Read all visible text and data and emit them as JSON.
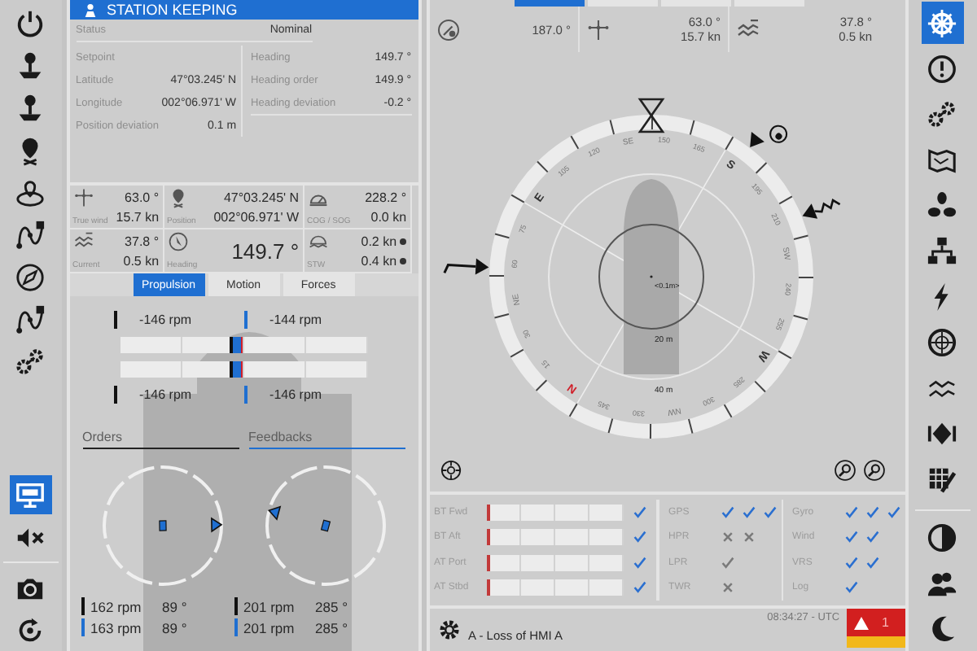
{
  "left_toolbar": [
    {
      "selected": false
    },
    {
      "selected": false
    },
    {
      "selected": false
    },
    {
      "selected": false
    },
    {
      "selected": false
    },
    {
      "selected": false
    },
    {
      "selected": false
    },
    {
      "selected": false
    },
    {
      "selected": false
    },
    {
      "selected": true
    },
    {
      "selected": false
    },
    {
      "selected": false
    },
    {
      "selected": false
    }
  ],
  "station_keeping": {
    "title": "STATION KEEPING",
    "status_label": "Status",
    "status": "Nominal",
    "setpoint": {
      "title": "Setpoint",
      "rows": [
        {
          "label": "Latitude",
          "value": "47°03.245' N"
        },
        {
          "label": "Longitude",
          "value": "002°06.971' W"
        }
      ],
      "deviation": {
        "label": "Position deviation",
        "value": "0.1 m"
      }
    },
    "heading": {
      "rows": [
        {
          "label": "Heading",
          "value": "149.7 °"
        },
        {
          "label": "Heading order",
          "value": "149.9 °"
        },
        {
          "label": "Heading deviation",
          "value": "-0.2 °"
        }
      ]
    }
  },
  "nav_info": [
    {
      "kind": "pair",
      "label": "True wind",
      "values": [
        "63.0 °",
        "15.7 kn"
      ]
    },
    {
      "kind": "pair",
      "label": "Position",
      "values": [
        "47°03.245' N",
        "002°06.971' W"
      ]
    },
    {
      "kind": "pair",
      "label": "COG / SOG",
      "values": [
        "228.2 °",
        "0.0 kn"
      ]
    },
    {
      "kind": "pair",
      "label": "Current",
      "values": [
        "37.8 °",
        "0.5 kn"
      ]
    },
    {
      "kind": "big",
      "label": "Heading",
      "values": [
        "149.7 °"
      ]
    },
    {
      "kind": "speed",
      "label": "STW",
      "values": [
        "0.2 kn",
        "0.4 kn"
      ]
    }
  ],
  "tabs": [
    {
      "label": "Propulsion",
      "selected": true
    },
    {
      "label": "Motion",
      "selected": false
    },
    {
      "label": "Forces",
      "selected": false
    }
  ],
  "thrusters": {
    "top_readings": [
      "-146 rpm",
      "-144 rpm"
    ],
    "bars": [
      {
        "level": 0.47
      },
      {
        "level": 0.47
      }
    ],
    "bottom_readings": [
      "-146 rpm",
      "-146 rpm"
    ]
  },
  "azimuths": {
    "headings": [
      "Orders",
      "Feedbacks"
    ],
    "rows": [
      {
        "kind": "order",
        "values": [
          "162 rpm",
          "89 °",
          "201 rpm",
          "285 °"
        ]
      },
      {
        "kind": "feedback",
        "values": [
          "163 rpm",
          "89 °",
          "201 rpm",
          "285 °"
        ]
      }
    ]
  },
  "nav_bar": [
    {
      "values": [
        "187.0 °"
      ]
    },
    {
      "values": [
        "63.0 °",
        "15.7 kn"
      ]
    },
    {
      "values": [
        "37.8 °",
        "0.5 kn"
      ]
    }
  ],
  "compass": {
    "ring_labels": [
      "N",
      "15",
      "30",
      "NE",
      "60",
      "75",
      "E",
      "105",
      "120",
      "SE",
      "150",
      "165",
      "S",
      "195",
      "210",
      "SW",
      "240",
      "255",
      "W",
      "285",
      "300",
      "NW",
      "330",
      "345"
    ],
    "center_label": "<0.1m>",
    "ranges": [
      "20 m",
      "40 m"
    ]
  },
  "sensors": {
    "thrusters": [
      {
        "label": "BT Fwd",
        "level": 0,
        "ok": true
      },
      {
        "label": "BT Aft",
        "level": 0,
        "ok": true
      },
      {
        "label": "AT Port",
        "level": 0,
        "ok": true
      },
      {
        "label": "AT Stbd",
        "level": 0,
        "ok": true
      }
    ],
    "groups": [
      [
        {
          "label": "GPS",
          "marks": [
            {
              "kind": "check",
              "active": true
            },
            {
              "kind": "check",
              "active": true
            },
            {
              "kind": "check",
              "active": true
            }
          ]
        },
        {
          "label": "HPR",
          "marks": [
            {
              "kind": "cross",
              "active": false
            },
            {
              "kind": "cross",
              "active": false
            }
          ]
        },
        {
          "label": "LPR",
          "marks": [
            {
              "kind": "check",
              "active": false
            }
          ]
        },
        {
          "label": "TWR",
          "marks": [
            {
              "kind": "cross",
              "active": false
            }
          ]
        }
      ],
      [
        {
          "label": "Gyro",
          "marks": [
            {
              "kind": "check",
              "active": true
            },
            {
              "kind": "check",
              "active": true
            },
            {
              "kind": "check",
              "active": true
            }
          ]
        },
        {
          "label": "Wind",
          "marks": [
            {
              "kind": "check",
              "active": true
            },
            {
              "kind": "check",
              "active": true
            }
          ]
        },
        {
          "label": "VRS",
          "marks": [
            {
              "kind": "check",
              "active": true
            },
            {
              "kind": "check",
              "active": true
            }
          ]
        },
        {
          "label": "Log",
          "marks": [
            {
              "kind": "check",
              "active": true
            }
          ]
        }
      ]
    ]
  },
  "alarm": {
    "message": "A - Loss of HMI A",
    "time": "08:34:27 - UTC",
    "count": "1"
  },
  "right_toolbar": [
    {
      "selected": true
    },
    {
      "selected": false
    },
    {
      "selected": false
    },
    {
      "selected": false
    },
    {
      "selected": false
    },
    {
      "selected": false
    },
    {
      "selected": false
    },
    {
      "selected": false
    },
    {
      "selected": false
    },
    {
      "selected": false
    },
    {
      "selected": false
    },
    {
      "selected": false
    },
    {
      "selected": false
    },
    {
      "selected": false
    }
  ]
}
